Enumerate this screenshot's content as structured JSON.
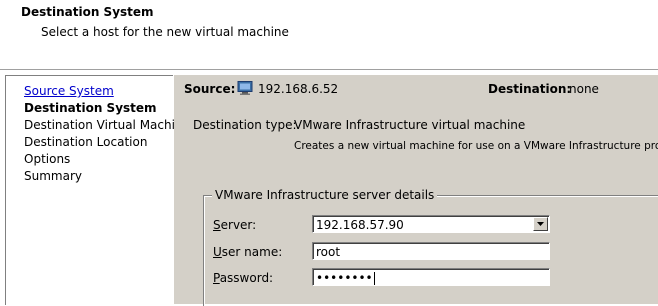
{
  "header": {
    "title": "Destination System",
    "subtitle": "Select a host for the new virtual machine"
  },
  "sidebar": {
    "items": [
      {
        "label": "Source System",
        "state": "link"
      },
      {
        "label": "Destination System",
        "state": "current"
      },
      {
        "label": "Destination Virtual Machine",
        "state": "normal"
      },
      {
        "label": "Destination Location",
        "state": "normal"
      },
      {
        "label": "Options",
        "state": "normal"
      },
      {
        "label": "Summary",
        "state": "normal"
      }
    ]
  },
  "main": {
    "source_label": "Source:",
    "source_icon": "monitor-icon",
    "source_value": "192.168.6.52",
    "destination_label": "Destination:",
    "destination_value": "none",
    "destination_type_label": "Destination type:",
    "destination_type_value": "VMware Infrastructure virtual machine",
    "destination_type_description": "Creates a new virtual machine for use on a VMware Infrastructure product.",
    "server_details": {
      "legend": "VMware Infrastructure server details",
      "server_label_prefix": "S",
      "server_label_rest": "erver:",
      "server_value": "192.168.57.90",
      "username_label_prefix": "U",
      "username_label_rest": "ser name:",
      "username_value": "root",
      "password_label_prefix": "P",
      "password_label_rest": "assword:",
      "password_value": "••••••••"
    }
  },
  "colors": {
    "panel_bg": "#d4d0c8",
    "link": "#0000cc"
  }
}
